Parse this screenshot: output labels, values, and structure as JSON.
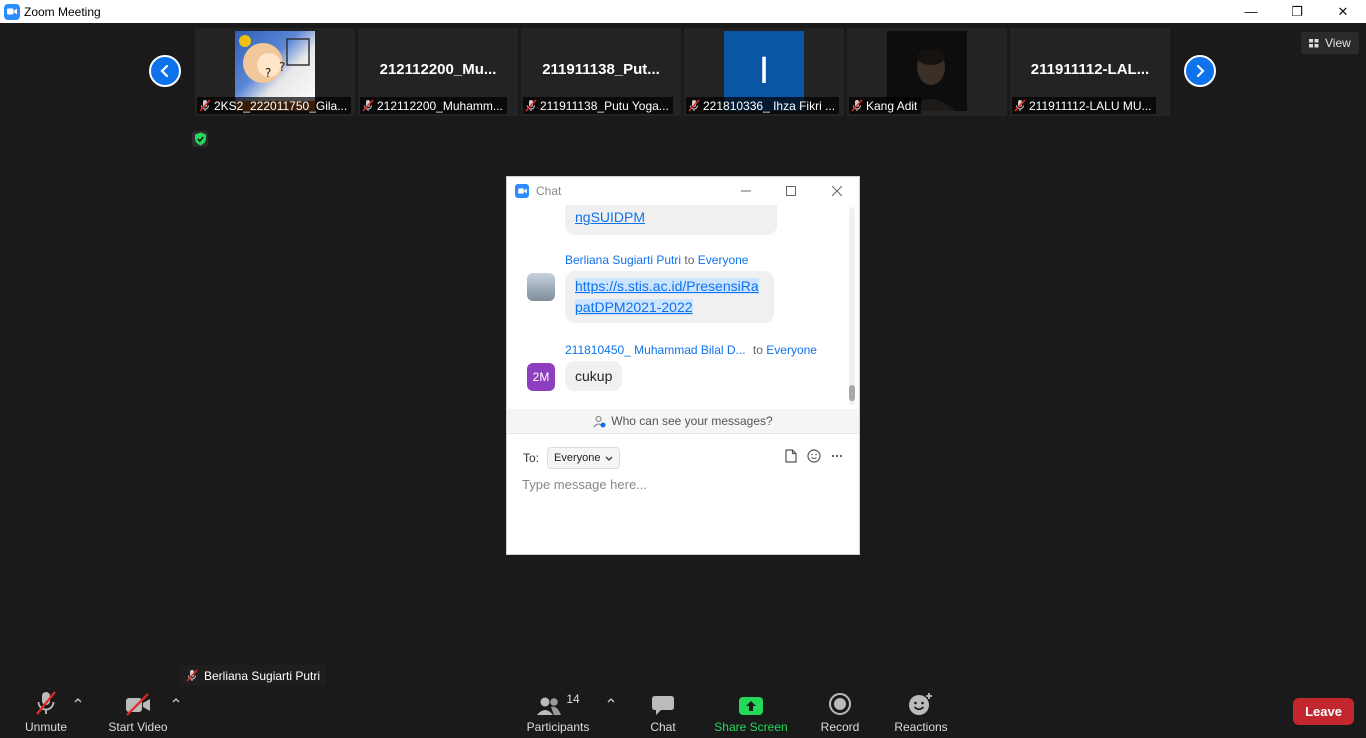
{
  "window": {
    "title": "Zoom Meeting",
    "minimize": "—",
    "restore": "❐",
    "close": "✕"
  },
  "view_button": {
    "label": "View"
  },
  "gallery": {
    "tiles": [
      {
        "caption": "2KS2_222011750_Gila..."
      },
      {
        "big_name": "212112200_Mu...",
        "caption": "212112200_Muhamm..."
      },
      {
        "big_name": "211911138_Put...",
        "caption": "211911138_Putu Yoga..."
      },
      {
        "avatar_letter": "I",
        "caption": "221810336_ Ihza Fikri ..."
      },
      {
        "caption": "Kang Adit"
      },
      {
        "big_name": "211911112-LAL...",
        "caption": "211911112-LALU MU..."
      }
    ]
  },
  "chat": {
    "title": "Chat",
    "messages": [
      {
        "text": "ngSUIDPM"
      },
      {
        "sender": "Berliana Sugiarti Putri",
        "to_word": "to",
        "recipient": "Everyone",
        "link_line1": "https://s.stis.ac.id/PresensiRa",
        "link_line2": "patDPM2021-2022"
      },
      {
        "sender": "211810450_ Muhammad Bilal D...",
        "to_word": "to",
        "recipient": "Everyone",
        "avatar": "2M",
        "text": "cukup"
      }
    ],
    "who_can_see": "Who can see your messages?",
    "to_label": "To:",
    "to_value": "Everyone",
    "input_placeholder": "Type message here..."
  },
  "self_label": "Berliana Sugiarti Putri",
  "toolbar": {
    "unmute": "Unmute",
    "start_video": "Start Video",
    "participants": "Participants",
    "participants_count": "14",
    "chat": "Chat",
    "share_screen": "Share Screen",
    "record": "Record",
    "reactions": "Reactions",
    "leave": "Leave"
  },
  "colors": {
    "accent": "#0e72ed",
    "share_green": "#23d959",
    "leave_red": "#c1272d",
    "background": "#1a1a1a"
  }
}
